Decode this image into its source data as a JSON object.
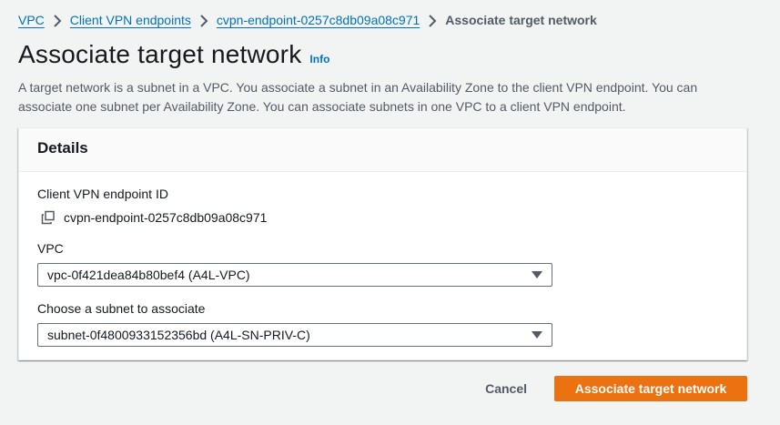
{
  "breadcrumb": {
    "items": [
      "VPC",
      "Client VPN endpoints",
      "cvpn-endpoint-0257c8db09a08c971"
    ],
    "current": "Associate target network"
  },
  "header": {
    "title": "Associate target network",
    "info": "Info",
    "description": "A target network is a subnet in a VPC. You associate a subnet in an Availability Zone to the client VPN endpoint. You can associate one subnet per Availability Zone. You can associate subnets in one VPC to a client VPN endpoint."
  },
  "details": {
    "title": "Details",
    "endpoint_label": "Client VPN endpoint ID",
    "endpoint_value": "cvpn-endpoint-0257c8db09a08c971",
    "copy_icon": "copy-icon",
    "vpc_label": "VPC",
    "vpc_value": "vpc-0f421dea84b80bef4 (A4L-VPC)",
    "subnet_label": "Choose a subnet to associate",
    "subnet_value": "subnet-0f4800933152356bd (A4L-SN-PRIV-C)"
  },
  "actions": {
    "cancel": "Cancel",
    "submit": "Associate target network"
  },
  "colors": {
    "link": "#0073bb",
    "primary": "#ec7211",
    "background": "#f2f3f3",
    "text": "#16191f",
    "secondary_text": "#545b64"
  }
}
